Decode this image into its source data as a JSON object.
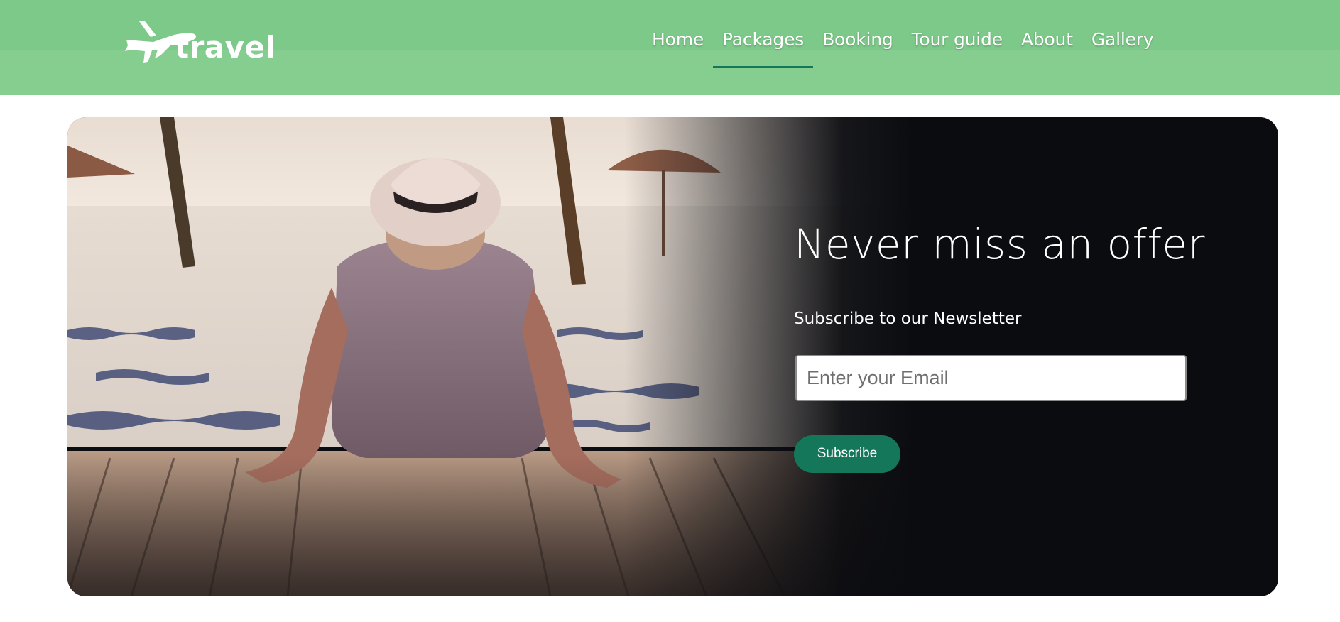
{
  "brand": {
    "logo_text": "travel",
    "logo_icon": "airplane-icon"
  },
  "nav": {
    "items": [
      {
        "label": "Home",
        "active": false
      },
      {
        "label": "Packages",
        "active": true
      },
      {
        "label": "Booking",
        "active": false
      },
      {
        "label": "Tour guide",
        "active": false
      },
      {
        "label": "About",
        "active": false
      },
      {
        "label": "Gallery",
        "active": false
      }
    ]
  },
  "hero": {
    "title": "Never miss an offer",
    "subtitle": "Subscribe to our Newsletter",
    "email_placeholder": "Enter your Email",
    "email_value": "",
    "subscribe_label": "Subscribe"
  },
  "colors": {
    "header_bg": "#7cc989",
    "accent": "#15775a",
    "hero_dark": "#0b0c10",
    "text_on_dark": "#ffffff"
  }
}
